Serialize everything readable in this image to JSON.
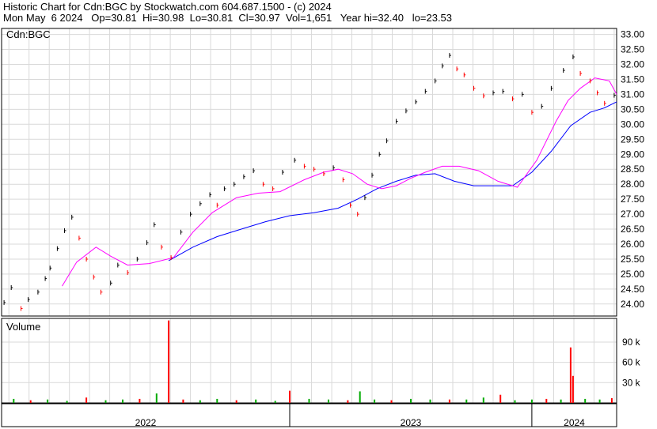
{
  "header": {
    "line1": "Historic Chart for Cdn:BGC by Stockwatch.com 604.687.1500 - (c) 2024",
    "line2": "Mon May  6 2024   Op=30.81  Hi=30.98  Lo=30.81  Cl=30.97  Vol=1,651   Year hi=32.40   lo=23.53"
  },
  "chart_data": {
    "type": "line",
    "title": "Historic Chart for Cdn:BGC by Stockwatch.com 604.687.1500 - (c) 2024",
    "symbol_label": "Cdn:BGC",
    "volume_label": "Volume",
    "price_axis": {
      "ticks": [
        "33.00",
        "32.50",
        "32.00",
        "31.50",
        "31.00",
        "30.50",
        "30.00",
        "29.50",
        "29.00",
        "28.50",
        "28.00",
        "27.50",
        "27.00",
        "26.50",
        "26.00",
        "25.50",
        "25.00",
        "24.50",
        "24.00"
      ],
      "ylim": [
        23.6,
        33.2
      ]
    },
    "volume_axis": {
      "ticks": [
        "90 k",
        "60 k",
        "30 k"
      ],
      "ylim": [
        0,
        125
      ]
    },
    "x_period_labels": [
      "2022",
      "2023",
      "2024"
    ],
    "x_range": [
      2021.81,
      2024.35
    ],
    "grid": true,
    "colors": {
      "price_up": "#000000",
      "price_down": "#ff0000",
      "ma_short": "#ff00ff",
      "ma_long": "#0000ff",
      "vol_up": "#00aa00",
      "vol_down": "#ff0000"
    },
    "price_series": [
      {
        "x": 2021.82,
        "c": 24.05
      },
      {
        "x": 2021.85,
        "c": 24.55
      },
      {
        "x": 2021.89,
        "c": 23.85
      },
      {
        "x": 2021.92,
        "c": 24.15
      },
      {
        "x": 2021.96,
        "c": 24.4
      },
      {
        "x": 2021.99,
        "c": 24.85
      },
      {
        "x": 2022.01,
        "c": 25.2
      },
      {
        "x": 2022.04,
        "c": 25.85
      },
      {
        "x": 2022.07,
        "c": 26.45
      },
      {
        "x": 2022.1,
        "c": 26.9
      },
      {
        "x": 2022.13,
        "c": 26.2
      },
      {
        "x": 2022.16,
        "c": 25.5
      },
      {
        "x": 2022.19,
        "c": 24.9
      },
      {
        "x": 2022.22,
        "c": 24.4
      },
      {
        "x": 2022.26,
        "c": 24.7
      },
      {
        "x": 2022.29,
        "c": 25.3
      },
      {
        "x": 2022.33,
        "c": 25.05
      },
      {
        "x": 2022.37,
        "c": 25.5
      },
      {
        "x": 2022.41,
        "c": 26.05
      },
      {
        "x": 2022.44,
        "c": 26.65
      },
      {
        "x": 2022.47,
        "c": 25.9
      },
      {
        "x": 2022.51,
        "c": 25.55
      },
      {
        "x": 2022.55,
        "c": 26.4
      },
      {
        "x": 2022.59,
        "c": 27.0
      },
      {
        "x": 2022.63,
        "c": 27.35
      },
      {
        "x": 2022.67,
        "c": 27.65
      },
      {
        "x": 2022.7,
        "c": 27.3
      },
      {
        "x": 2022.73,
        "c": 27.85
      },
      {
        "x": 2022.77,
        "c": 28.0
      },
      {
        "x": 2022.81,
        "c": 28.25
      },
      {
        "x": 2022.85,
        "c": 28.45
      },
      {
        "x": 2022.89,
        "c": 28.0
      },
      {
        "x": 2022.93,
        "c": 27.85
      },
      {
        "x": 2022.97,
        "c": 28.4
      },
      {
        "x": 2023.02,
        "c": 28.8
      },
      {
        "x": 2023.06,
        "c": 28.6
      },
      {
        "x": 2023.1,
        "c": 28.5
      },
      {
        "x": 2023.14,
        "c": 28.35
      },
      {
        "x": 2023.18,
        "c": 28.55
      },
      {
        "x": 2023.22,
        "c": 28.15
      },
      {
        "x": 2023.25,
        "c": 27.3
      },
      {
        "x": 2023.28,
        "c": 27.0
      },
      {
        "x": 2023.31,
        "c": 27.55
      },
      {
        "x": 2023.34,
        "c": 28.3
      },
      {
        "x": 2023.37,
        "c": 29.0
      },
      {
        "x": 2023.4,
        "c": 29.45
      },
      {
        "x": 2023.44,
        "c": 30.1
      },
      {
        "x": 2023.48,
        "c": 30.45
      },
      {
        "x": 2023.52,
        "c": 30.75
      },
      {
        "x": 2023.56,
        "c": 31.1
      },
      {
        "x": 2023.6,
        "c": 31.45
      },
      {
        "x": 2023.63,
        "c": 31.95
      },
      {
        "x": 2023.66,
        "c": 32.3
      },
      {
        "x": 2023.69,
        "c": 31.85
      },
      {
        "x": 2023.72,
        "c": 31.65
      },
      {
        "x": 2023.76,
        "c": 31.2
      },
      {
        "x": 2023.8,
        "c": 30.95
      },
      {
        "x": 2023.84,
        "c": 31.05
      },
      {
        "x": 2023.88,
        "c": 31.1
      },
      {
        "x": 2023.92,
        "c": 30.85
      },
      {
        "x": 2023.96,
        "c": 31.0
      },
      {
        "x": 2024.0,
        "c": 30.4
      },
      {
        "x": 2024.04,
        "c": 30.6
      },
      {
        "x": 2024.08,
        "c": 31.2
      },
      {
        "x": 2024.13,
        "c": 31.8
      },
      {
        "x": 2024.17,
        "c": 32.25
      },
      {
        "x": 2024.2,
        "c": 31.7
      },
      {
        "x": 2024.24,
        "c": 31.45
      },
      {
        "x": 2024.27,
        "c": 31.05
      },
      {
        "x": 2024.3,
        "c": 30.7
      },
      {
        "x": 2024.34,
        "c": 30.97
      }
    ],
    "ma_short": {
      "x": [
        2022.06,
        2022.12,
        2022.2,
        2022.26,
        2022.33,
        2022.42,
        2022.52,
        2022.6,
        2022.68,
        2022.78,
        2022.87,
        2022.96,
        2023.06,
        2023.14,
        2023.2,
        2023.26,
        2023.32,
        2023.38,
        2023.44,
        2023.5,
        2023.56,
        2023.63,
        2023.7,
        2023.78,
        2023.86,
        2023.94,
        2024.02,
        2024.1,
        2024.15,
        2024.2,
        2024.26,
        2024.32,
        2024.35
      ],
      "values": [
        24.6,
        25.4,
        25.9,
        25.6,
        25.3,
        25.35,
        25.55,
        26.4,
        27.05,
        27.55,
        27.7,
        27.75,
        28.15,
        28.4,
        28.5,
        28.35,
        28.0,
        27.85,
        27.95,
        28.2,
        28.4,
        28.6,
        28.6,
        28.45,
        28.1,
        27.9,
        28.8,
        30.1,
        30.8,
        31.2,
        31.55,
        31.45,
        31.0
      ]
    },
    "ma_long": {
      "x": [
        2022.5,
        2022.6,
        2022.7,
        2022.8,
        2022.9,
        2023.0,
        2023.1,
        2023.2,
        2023.28,
        2023.36,
        2023.44,
        2023.52,
        2023.6,
        2023.68,
        2023.76,
        2023.84,
        2023.92,
        2024.0,
        2024.08,
        2024.16,
        2024.24,
        2024.3,
        2024.35
      ],
      "values": [
        25.45,
        25.9,
        26.25,
        26.5,
        26.75,
        26.95,
        27.05,
        27.2,
        27.5,
        27.85,
        28.1,
        28.3,
        28.35,
        28.1,
        27.95,
        27.95,
        27.95,
        28.4,
        29.1,
        29.95,
        30.4,
        30.55,
        30.75
      ]
    },
    "volume_series": [
      {
        "x": 2021.86,
        "v": 6
      },
      {
        "x": 2021.93,
        "v": 4
      },
      {
        "x": 2022.0,
        "v": 5
      },
      {
        "x": 2022.08,
        "v": 3
      },
      {
        "x": 2022.16,
        "v": 8
      },
      {
        "x": 2022.24,
        "v": 4
      },
      {
        "x": 2022.31,
        "v": 5
      },
      {
        "x": 2022.38,
        "v": 6
      },
      {
        "x": 2022.45,
        "v": 14
      },
      {
        "x": 2022.5,
        "v": 122
      },
      {
        "x": 2022.56,
        "v": 5
      },
      {
        "x": 2022.63,
        "v": 4
      },
      {
        "x": 2022.7,
        "v": 6
      },
      {
        "x": 2022.78,
        "v": 4
      },
      {
        "x": 2022.86,
        "v": 5
      },
      {
        "x": 2022.94,
        "v": 3
      },
      {
        "x": 2023.0,
        "v": 18
      },
      {
        "x": 2023.08,
        "v": 6
      },
      {
        "x": 2023.16,
        "v": 5
      },
      {
        "x": 2023.24,
        "v": 4
      },
      {
        "x": 2023.29,
        "v": 17
      },
      {
        "x": 2023.35,
        "v": 5
      },
      {
        "x": 2023.42,
        "v": 4
      },
      {
        "x": 2023.5,
        "v": 6
      },
      {
        "x": 2023.58,
        "v": 5
      },
      {
        "x": 2023.66,
        "v": 5
      },
      {
        "x": 2023.73,
        "v": 5
      },
      {
        "x": 2023.8,
        "v": 8
      },
      {
        "x": 2023.87,
        "v": 12
      },
      {
        "x": 2023.93,
        "v": 4
      },
      {
        "x": 2024.0,
        "v": 5
      },
      {
        "x": 2024.06,
        "v": 6
      },
      {
        "x": 2024.12,
        "v": 5
      },
      {
        "x": 2024.16,
        "v": 82
      },
      {
        "x": 2024.17,
        "v": 40
      },
      {
        "x": 2024.22,
        "v": 6
      },
      {
        "x": 2024.28,
        "v": 5
      },
      {
        "x": 2024.33,
        "v": 7
      }
    ]
  }
}
